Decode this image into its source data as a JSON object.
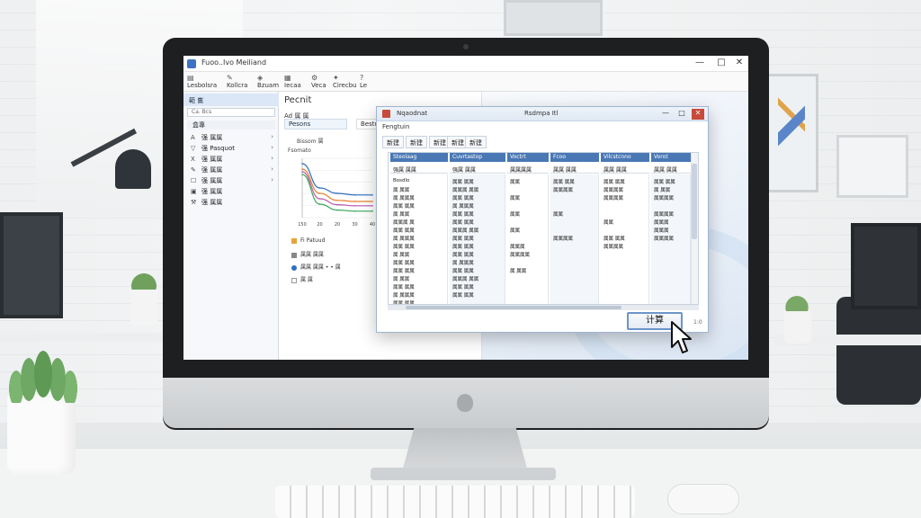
{
  "app": {
    "title": "Fuoo..Ivo Meiliand",
    "controls": [
      "—",
      "□",
      "✕"
    ],
    "toolbar": [
      {
        "icon": "file-icon",
        "label": "Lesbolsra"
      },
      {
        "icon": "edit-icon",
        "label": "Kollcra"
      },
      {
        "icon": "view-icon",
        "label": "Bzuam"
      },
      {
        "icon": "chart-icon",
        "label": "Iecaa"
      },
      {
        "icon": "gear-icon",
        "label": "Veca"
      },
      {
        "icon": "tools-icon",
        "label": "Cirecbu"
      },
      {
        "icon": "help-icon",
        "label": "Le"
      }
    ]
  },
  "sidebar": {
    "header": "範 巂",
    "search_placeholder": "Ca. Bcs",
    "sub": "盒專",
    "items": [
      {
        "icon": "a-icon",
        "label": "强 属属"
      },
      {
        "icon": "filter-icon",
        "label": "强 Pasquot"
      },
      {
        "icon": "x-icon",
        "label": "强 属属"
      },
      {
        "icon": "pencil-icon",
        "label": "强 属属"
      },
      {
        "icon": "checkbox-icon",
        "label": "强 属属"
      },
      {
        "icon": "block-icon",
        "label": "强 属属"
      },
      {
        "icon": "wrench-icon",
        "label": "强 属属"
      }
    ]
  },
  "content": {
    "title": "Pecnit",
    "subtitle": "Ad 属 属",
    "tab_active": "Pesons",
    "tab_other": "Bestu",
    "chart_label_top": "Bissom 属",
    "chart_label_side": "Fsomato",
    "legend": [
      {
        "label": "Fi Patuud",
        "color": "#e8a23a"
      },
      {
        "label": "属属 属属",
        "color": "#888888"
      },
      {
        "label": "属属 属属  • • 属",
        "color": "#2f6fbf"
      },
      {
        "label": "属 属",
        "color": "#bbbbbb"
      }
    ]
  },
  "chart_data": {
    "type": "line",
    "title": "",
    "xlabel": "",
    "ylabel": "",
    "x": [
      "150",
      "20",
      "20",
      "30",
      "40"
    ],
    "series": [
      {
        "values": [
          1.0,
          0.55,
          0.45,
          0.42,
          0.42
        ],
        "color": "#2f6fbf"
      },
      {
        "values": [
          0.9,
          0.45,
          0.32,
          0.3,
          0.3
        ],
        "color": "#e8812e"
      },
      {
        "values": [
          0.85,
          0.35,
          0.24,
          0.22,
          0.22
        ],
        "color": "#b55ab0"
      },
      {
        "values": [
          0.8,
          0.25,
          0.14,
          0.12,
          0.12
        ],
        "color": "#3aa65a"
      }
    ],
    "ylim": [
      0,
      1.1
    ],
    "grid": true
  },
  "dialog": {
    "title": "Nqaodnat",
    "title_right": "Rsdmpa Itl",
    "subtitle": "Fengtuin",
    "controls": [
      "—",
      "□",
      "✕"
    ],
    "tabs": [
      {
        "label": "新建"
      },
      {
        "label": "新建"
      },
      {
        "label": "新建"
      },
      {
        "label": "新建"
      },
      {
        "label": "新建"
      }
    ],
    "grid": {
      "headers": [
        "Steolaag",
        "Cuvrtastop",
        "Voctrt",
        "Fcoo",
        "Vilcstcnno",
        "Vorot"
      ],
      "subheaders": [
        "强属 属属",
        "强属 属属",
        "属属属属",
        "属属 属属",
        "属属 属属",
        "属属 属属"
      ],
      "col1": [
        "Bosdlo",
        "属 属属",
        "属 属属属",
        "属属 属属",
        "属 属属",
        "属属属 属",
        "属属 属属",
        "属 属属属",
        "属属 属属",
        "属 属属",
        "属属 属属",
        "属属 属属",
        "属 属属",
        "属属 属属",
        "属 属属属",
        "属属 属属"
      ],
      "col2": [
        "属属 属属",
        "属属属 属属",
        "属属 属属",
        "属 属属属",
        "属属 属属",
        "属属 属属",
        "属属属 属属",
        "属属 属属",
        "属属 属属",
        "属属 属属",
        "属 属属属",
        "属属 属属",
        "属属属 属属",
        "属属 属属",
        "属属 属属"
      ],
      "col3": [
        "属属",
        "",
        "属属",
        "",
        "属属",
        "",
        "属属",
        "",
        "属属属",
        "属属属属",
        "",
        "属 属属"
      ],
      "col4": [
        "属属 属属",
        "属属属属",
        "",
        "",
        "属属",
        "",
        "",
        "属属属属"
      ],
      "col5": [
        "属属 属属",
        "属属属属",
        "属属属属",
        "",
        "",
        "属属",
        "",
        "属属 属属",
        "属属属属"
      ],
      "col6": [
        "属属 属属",
        "属 属属",
        "属属属属",
        "",
        "属属属属",
        "属属属",
        "属属属",
        "属属属属"
      ]
    },
    "calculate_label": "计算",
    "corner_text": "1:0"
  }
}
